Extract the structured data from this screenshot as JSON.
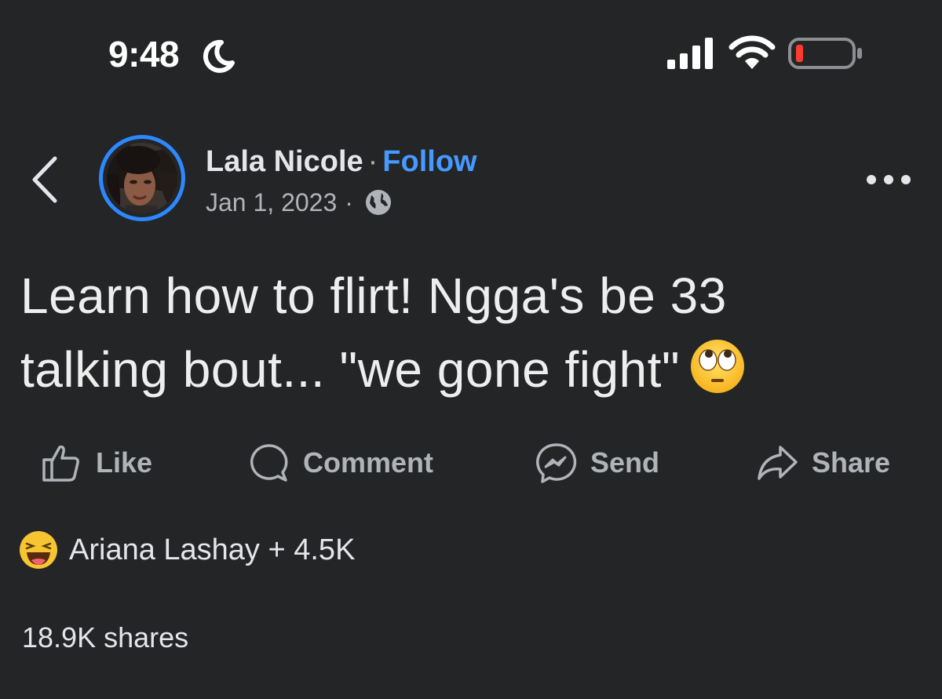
{
  "status_bar": {
    "time": "9:48",
    "icons": [
      "moon-icon",
      "signal-icon",
      "wifi-icon",
      "battery-low-icon"
    ],
    "battery_color": "#ff3b30"
  },
  "post": {
    "author": "Lala Nicole",
    "separator": "·",
    "follow_label": "Follow",
    "date": "Jan 1, 2023",
    "privacy_icon": "globe-icon",
    "text_line1": "Learn how to flirt! Ngga's be 33",
    "text_line2": "talking bout... \"we gone fight\"",
    "text_emoji": "eye-roll-emoji"
  },
  "actions": {
    "like": "Like",
    "comment": "Comment",
    "send": "Send",
    "share": "Share"
  },
  "reactions": {
    "summary": "Ariana Lashay + 4.5K",
    "icon": "haha-reaction-icon"
  },
  "shares_count": "18.9K shares",
  "colors": {
    "background": "#242526",
    "accent": "#4599ff",
    "avatar_ring": "#2d88ff",
    "secondary_text": "#b0b3b8"
  }
}
